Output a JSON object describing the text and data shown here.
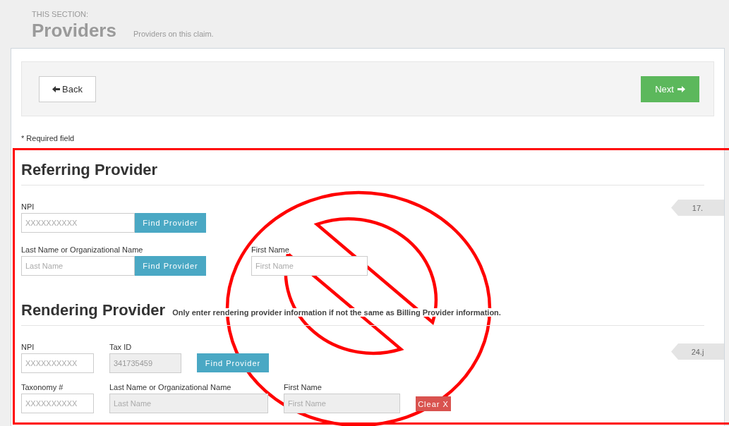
{
  "header": {
    "eyebrow": "THIS SECTION:",
    "title": "Providers",
    "subtitle": "Providers on this claim."
  },
  "nav": {
    "back": "Back",
    "next": "Next"
  },
  "required_note": "* Required field",
  "sections": [
    {
      "title": "Referring Provider",
      "tag": "17.",
      "rows": [
        [
          {
            "kind": "field",
            "label": "NPI",
            "placeholder": "XXXXXXXXXX",
            "disabled": false,
            "button": "Find Provider"
          }
        ],
        [
          {
            "kind": "field",
            "label": "Last Name or Organizational Name",
            "placeholder": "Last Name",
            "disabled": false,
            "button": "Find Provider"
          },
          {
            "kind": "field",
            "label": "First Name",
            "placeholder": "First Name",
            "disabled": false
          }
        ]
      ]
    },
    {
      "title": "Rendering Provider",
      "note": "Only enter rendering provider information if not the same as Billing Provider information.",
      "tag": "24.j",
      "rows": [
        [
          {
            "kind": "field",
            "label": "NPI",
            "placeholder": "XXXXXXXXXX",
            "disabled": false
          },
          {
            "kind": "field",
            "label": "Tax ID",
            "value": "341735459",
            "disabled": true
          },
          {
            "kind": "button",
            "text": "Find Provider",
            "color": "#4aa8c4"
          }
        ],
        [
          {
            "kind": "field",
            "label": "Taxonomy #",
            "placeholder": "XXXXXXXXXX",
            "disabled": false
          },
          {
            "kind": "field",
            "label": "Last Name or Organizational Name",
            "placeholder": "Last Name",
            "disabled": true
          },
          {
            "kind": "field",
            "label": "First Name",
            "placeholder": "First Name",
            "disabled": true
          },
          {
            "kind": "button",
            "text": "Clear X",
            "color": "#d9534f"
          }
        ]
      ]
    }
  ]
}
